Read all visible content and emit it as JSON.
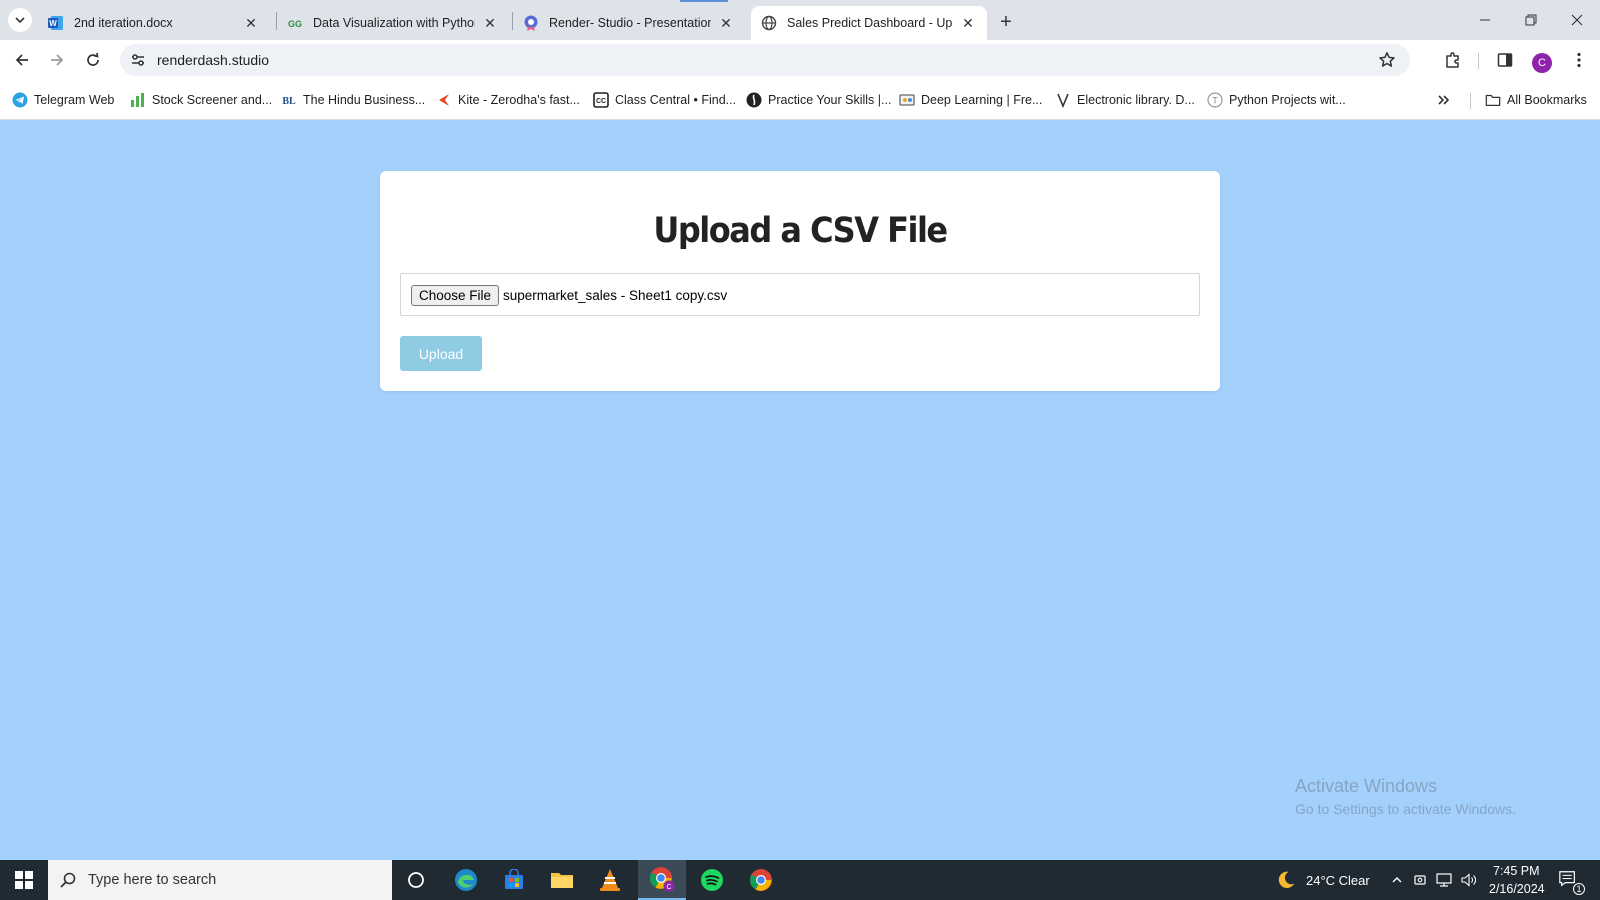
{
  "browser": {
    "tabs": [
      {
        "title": "2nd iteration.docx",
        "icon": "word-icon"
      },
      {
        "title": "Data Visualization with Python",
        "icon": "geeksforgeeks-icon"
      },
      {
        "title": "Render- Studio - Presentation",
        "icon": "render-studio-icon"
      },
      {
        "title": "Sales Predict Dashboard - Uplo",
        "icon": "globe-icon",
        "active": true
      }
    ],
    "url": "renderdash.studio",
    "profile_initial": "C",
    "bookmarks": [
      {
        "label": "Telegram Web",
        "icon": "telegram-icon"
      },
      {
        "label": "Stock Screener and...",
        "icon": "bar-chart-icon"
      },
      {
        "label": "The Hindu Business...",
        "icon": "businessline-icon"
      },
      {
        "label": "Kite - Zerodha's fast...",
        "icon": "kite-icon"
      },
      {
        "label": "Class Central • Find...",
        "icon": "class-central-icon"
      },
      {
        "label": "Practice Your Skills |...",
        "icon": "practice-icon"
      },
      {
        "label": "Deep Learning | Fre...",
        "icon": "deep-learning-icon"
      },
      {
        "label": "Electronic library. D...",
        "icon": "library-icon"
      },
      {
        "label": "Python Projects wit...",
        "icon": "python-projects-icon"
      }
    ],
    "all_bookmarks_label": "All Bookmarks"
  },
  "page": {
    "background_color": "#a3d1fc",
    "card": {
      "title": "Upload a CSV File",
      "choose_file_label": "Choose File",
      "selected_file": "supermarket_sales - Sheet1 copy.csv",
      "upload_label": "Upload",
      "upload_color": "#8fcce3"
    }
  },
  "watermark": {
    "line1": "Activate Windows",
    "line2": "Go to Settings to activate Windows."
  },
  "taskbar": {
    "search_placeholder": "Type here to search",
    "weather": "24°C  Clear",
    "time": "7:45 PM",
    "date": "2/16/2024",
    "notification_count": "1"
  }
}
